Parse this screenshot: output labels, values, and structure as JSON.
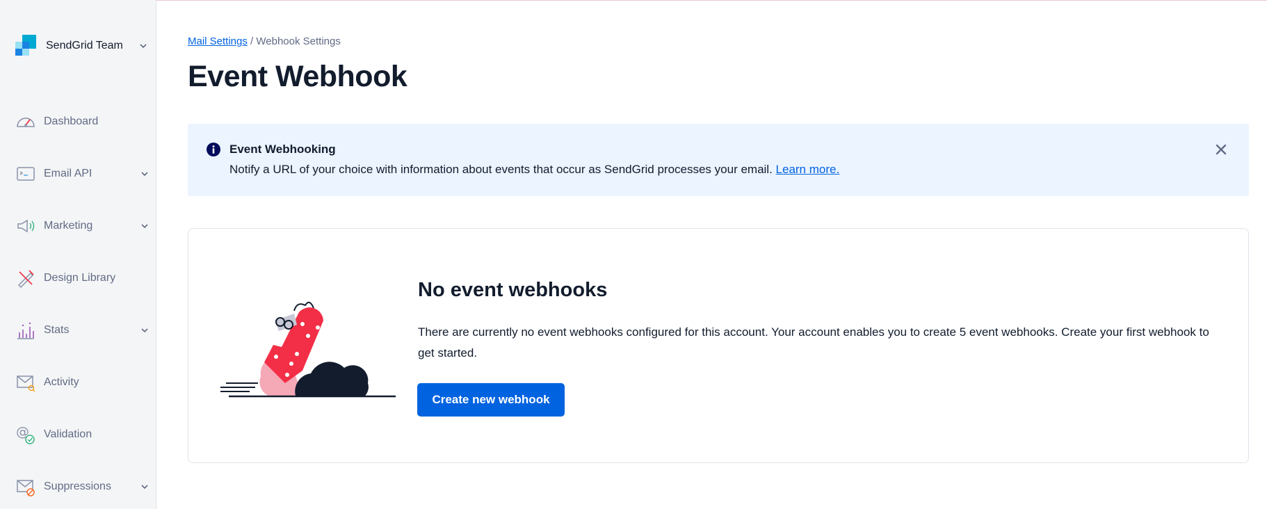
{
  "sidebar": {
    "team_name": "SendGrid Team",
    "items": [
      {
        "label": "Dashboard",
        "icon": "dashboard-gauge-icon",
        "has_chevron": false
      },
      {
        "label": "Email API",
        "icon": "email-api-icon",
        "has_chevron": true
      },
      {
        "label": "Marketing",
        "icon": "megaphone-icon",
        "has_chevron": true
      },
      {
        "label": "Design Library",
        "icon": "design-tools-icon",
        "has_chevron": false
      },
      {
        "label": "Stats",
        "icon": "stats-chart-icon",
        "has_chevron": true
      },
      {
        "label": "Activity",
        "icon": "activity-envelope-icon",
        "has_chevron": false
      },
      {
        "label": "Validation",
        "icon": "validation-at-icon",
        "has_chevron": false
      },
      {
        "label": "Suppressions",
        "icon": "suppressions-envelope-icon",
        "has_chevron": true
      }
    ]
  },
  "breadcrumb": {
    "parent": "Mail Settings",
    "separator": " / ",
    "current": "Webhook Settings"
  },
  "page_title": "Event Webhook",
  "banner": {
    "title": "Event Webhooking",
    "text": "Notify a URL of your choice with information about events that occur as SendGrid processes your email. ",
    "link": "Learn more."
  },
  "empty_state": {
    "title": "No event webhooks",
    "text": "There are currently no event webhooks configured for this account. Your account enables you to create 5 event webhooks. Create your first webhook to get started.",
    "button": "Create new webhook"
  },
  "colors": {
    "brand_blue": "#0263e0",
    "logo_light": "#9dd6e3",
    "logo_mid": "#3f72ab",
    "logo_accent": "#00a9d1",
    "banner_bg": "#ebf4ff",
    "info_icon": "#030b5d"
  }
}
